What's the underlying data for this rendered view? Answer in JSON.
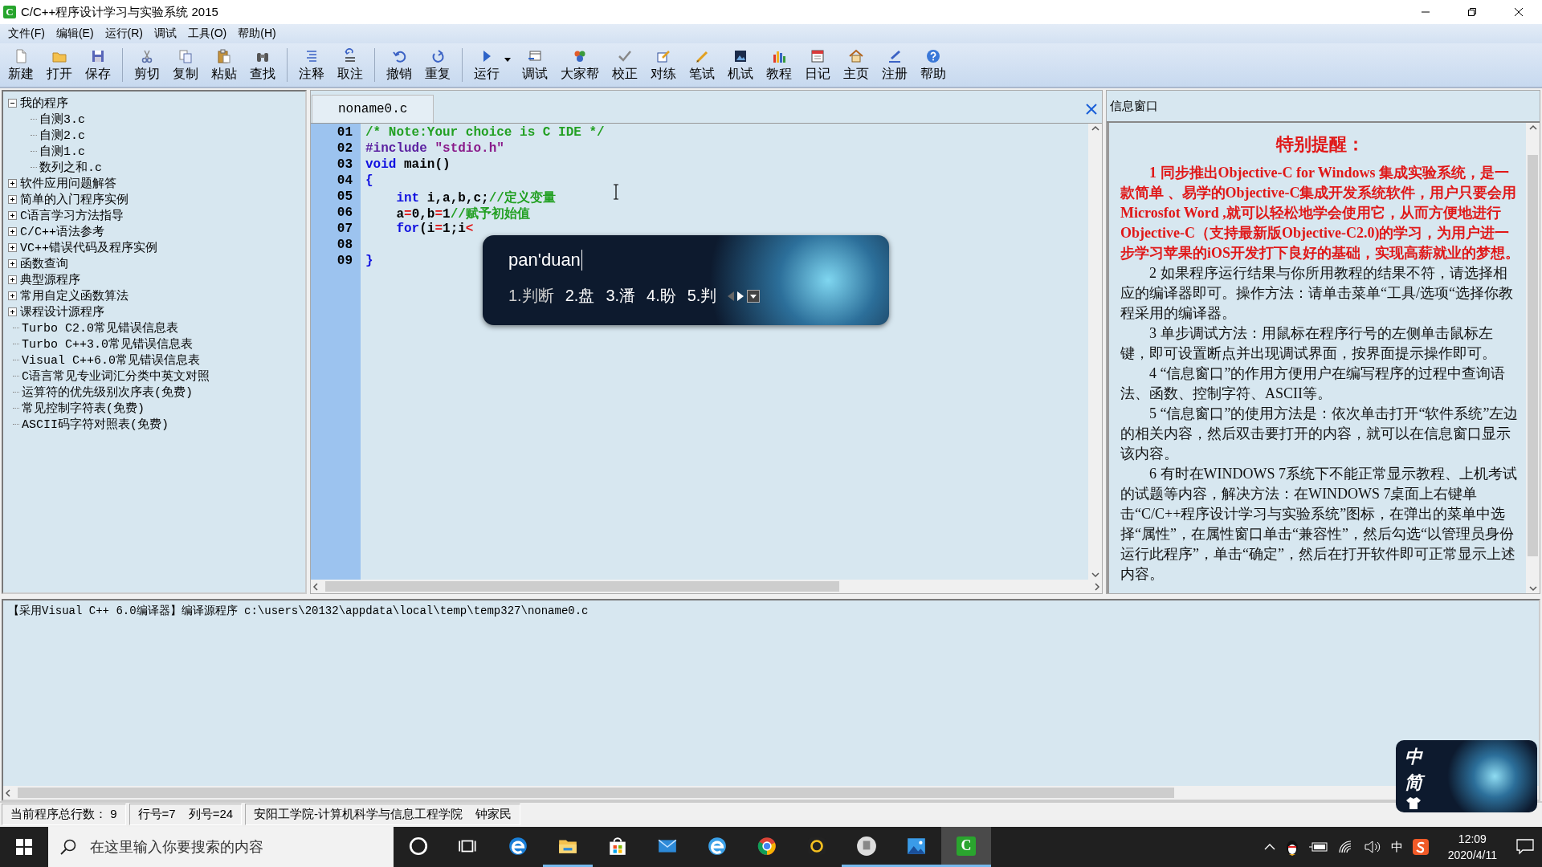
{
  "window": {
    "icon_text": "C",
    "title": "C/C++程序设计学习与实验系统 2015"
  },
  "menu": [
    "文件(F)",
    "编辑(E)",
    "运行(R)",
    "调试",
    "工具(O)",
    "帮助(H)"
  ],
  "toolbar": [
    {
      "label": "新建"
    },
    {
      "label": "打开"
    },
    {
      "label": "保存",
      "separator_after": true
    },
    {
      "label": "剪切"
    },
    {
      "label": "复制"
    },
    {
      "label": "粘贴"
    },
    {
      "label": "查找",
      "separator_after": true
    },
    {
      "label": "注释"
    },
    {
      "label": "取注",
      "separator_after": true
    },
    {
      "label": "撤销"
    },
    {
      "label": "重复",
      "separator_after": true
    },
    {
      "label": "运行",
      "dropdown": true
    },
    {
      "label": "调试"
    },
    {
      "label": "大家帮"
    },
    {
      "label": "校正"
    },
    {
      "label": "对练"
    },
    {
      "label": "笔试"
    },
    {
      "label": "机试"
    },
    {
      "label": "教程"
    },
    {
      "label": "日记"
    },
    {
      "label": "主页"
    },
    {
      "label": "注册"
    },
    {
      "label": "帮助"
    }
  ],
  "tree": [
    {
      "label": "我的程序",
      "kind": "folder",
      "expanded": true,
      "children": [
        {
          "label": "自测3.c",
          "kind": "file"
        },
        {
          "label": "自测2.c",
          "kind": "file"
        },
        {
          "label": "自测1.c",
          "kind": "file"
        },
        {
          "label": "数列之和.c",
          "kind": "file"
        }
      ]
    },
    {
      "label": "软件应用问题解答",
      "kind": "folder",
      "expanded": false
    },
    {
      "label": "简单的入门程序实例",
      "kind": "folder",
      "expanded": false
    },
    {
      "label": "C语言学习方法指导",
      "kind": "folder",
      "expanded": false
    },
    {
      "label": "C/C++语法参考",
      "kind": "folder",
      "expanded": false
    },
    {
      "label": "VC++错误代码及程序实例",
      "kind": "folder",
      "expanded": false
    },
    {
      "label": "函数查询",
      "kind": "folder",
      "expanded": false
    },
    {
      "label": "典型源程序",
      "kind": "folder",
      "expanded": false
    },
    {
      "label": "常用自定义函数算法",
      "kind": "folder",
      "expanded": false
    },
    {
      "label": "课程设计源程序",
      "kind": "folder",
      "expanded": false
    },
    {
      "label": "Turbo C2.0常见错误信息表",
      "kind": "file"
    },
    {
      "label": "Turbo C++3.0常见错误信息表",
      "kind": "file"
    },
    {
      "label": "Visual C++6.0常见错误信息表",
      "kind": "file"
    },
    {
      "label": "C语言常见专业词汇分类中英文对照",
      "kind": "file"
    },
    {
      "label": "运算符的优先级别次序表(免费)",
      "kind": "file"
    },
    {
      "label": "常见控制字符表(免费)",
      "kind": "file"
    },
    {
      "label": "ASCII码字符对照表(免费)",
      "kind": "file"
    }
  ],
  "editor": {
    "tab": "noname0.c",
    "lines": [
      {
        "number": "01",
        "tokens": [
          {
            "kind": "comment",
            "text": "/* Note:Your choice is C IDE */"
          }
        ]
      },
      {
        "number": "02",
        "tokens": [
          {
            "kind": "preprocessor",
            "text": "#include "
          },
          {
            "kind": "string",
            "text": "\"stdio.h\""
          }
        ]
      },
      {
        "number": "03",
        "tokens": [
          {
            "kind": "keyword",
            "text": "void"
          },
          {
            "kind": "plain",
            "text": " main()"
          }
        ]
      },
      {
        "number": "04",
        "tokens": [
          {
            "kind": "keyword",
            "text": "{"
          }
        ]
      },
      {
        "number": "05",
        "tokens": [
          {
            "kind": "keyword",
            "text": "    int"
          },
          {
            "kind": "plain",
            "text": " i,a,b,c;"
          },
          {
            "kind": "comment",
            "text": "//定义变量"
          }
        ]
      },
      {
        "number": "06",
        "tokens": [
          {
            "kind": "plain",
            "text": "    a"
          },
          {
            "kind": "operator",
            "text": "="
          },
          {
            "kind": "plain",
            "text": "0,b"
          },
          {
            "kind": "operator",
            "text": "="
          },
          {
            "kind": "plain",
            "text": "1"
          },
          {
            "kind": "comment",
            "text": "//赋予初始值"
          }
        ]
      },
      {
        "number": "07",
        "tokens": [
          {
            "kind": "keyword",
            "text": "    for"
          },
          {
            "kind": "plain",
            "text": "(i"
          },
          {
            "kind": "operator",
            "text": "="
          },
          {
            "kind": "plain",
            "text": "1;i"
          },
          {
            "kind": "operator",
            "text": "<"
          }
        ]
      },
      {
        "number": "08"
      },
      {
        "number": "09",
        "tokens": [
          {
            "kind": "keyword",
            "text": "}"
          }
        ]
      }
    ]
  },
  "ime": {
    "composition": "pan'duan",
    "candidates": [
      "1.判断",
      "2.盘",
      "3.潘",
      "4.盼",
      "5.判"
    ],
    "prev_enabled": false,
    "next_enabled": true
  },
  "info": {
    "title": "信息窗口",
    "heading": "特别提醒：",
    "paragraphs": [
      {
        "text": "1 同步推出Objective-C for Windows 集成实验系统，是一款简单 、易学的Objective-C集成开发系统软件，用户只要会用Microsfot Word ,就可以轻松地学会使用它，从而方便地进行Objective-C（支持最新版Objective-C2.0)的学习，为用户进一步学习苹果的iOS开发打下良好的基础，实现高薪就业的梦想。",
        "highlighted": true
      },
      {
        "text": "2 如果程序运行结果与你所用教程的结果不符，请选择相应的编译器即可。操作方法：请单击菜单“工具/选项“选择你教程采用的编译器。",
        "highlighted": false
      },
      {
        "text": "3 单步调试方法：用鼠标在程序行号的左侧单击鼠标左键，即可设置断点并出现调试界面，按界面提示操作即可。",
        "highlighted": false
      },
      {
        "text": "4 “信息窗口”的作用方便用户在编写程序的过程中查询语法、函数、控制字符、ASCII等。",
        "highlighted": false
      },
      {
        "text": "5 “信息窗口”的使用方法是：依次单击打开“软件系统”左边的相关内容，然后双击要打开的内容，就可以在信息窗口显示该内容。",
        "highlighted": false
      },
      {
        "text": "6 有时在WINDOWS 7系统下不能正常显示教程、上机考试的试题等内容，解决方法：在WINDOWS 7桌面上右键单击“C/C++程序设计学习与实验系统”图标，在弹出的菜单中选择“属性”，在属性窗口单击“兼容性”，然后勾选“以管理员身份运行此程序”，单击“确定”，然后在打开软件即可正常显示上述内容。",
        "highlighted": false
      }
    ]
  },
  "output": {
    "text": "【采用Visual C++ 6.0编译器】编译源程序 c:\\users\\20132\\appdata\\local\\temp\\temp327\\noname0.c"
  },
  "status_bar": [
    [
      "当前程序总行数： 9"
    ],
    [
      "行号=7",
      "列号=24"
    ],
    [
      "安阳工学院-计算机科学与信息工程学院",
      "钟家民"
    ]
  ],
  "ime_bar": {
    "mode": "中",
    "script": "简"
  },
  "taskbar": {
    "search_placeholder": "在这里输入你要搜索的内容",
    "app_icon_text": "C",
    "apps": [
      {
        "running": false,
        "selected": false
      },
      {
        "running": false,
        "selected": false
      },
      {
        "running": false,
        "selected": false
      },
      {
        "running": true,
        "selected": false
      },
      {
        "running": false,
        "selected": false
      },
      {
        "running": false,
        "selected": false
      },
      {
        "running": false,
        "selected": false
      },
      {
        "running": false,
        "selected": false
      },
      {
        "running": false,
        "selected": false
      },
      {
        "running": true,
        "selected": false
      },
      {
        "running": true,
        "selected": false
      },
      {
        "running": true,
        "selected": true
      }
    ],
    "tray_ime": "中",
    "time": "12:09",
    "date": "2020/4/11"
  }
}
